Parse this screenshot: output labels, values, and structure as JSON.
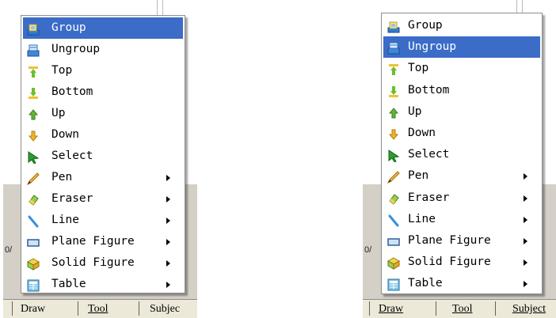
{
  "panels": [
    {
      "highlighted": 0,
      "partial_text": "0/",
      "menu": [
        {
          "label": "Group",
          "icon": "group-icon",
          "submenu": false
        },
        {
          "label": "Ungroup",
          "icon": "ungroup-icon",
          "submenu": false
        },
        {
          "label": "Top",
          "icon": "top-icon",
          "submenu": false
        },
        {
          "label": "Bottom",
          "icon": "bottom-icon",
          "submenu": false
        },
        {
          "label": "Up",
          "icon": "up-arrow-icon",
          "submenu": false
        },
        {
          "label": "Down",
          "icon": "down-arrow-icon",
          "submenu": false
        },
        {
          "label": "Select",
          "icon": "select-cursor-icon",
          "submenu": false
        },
        {
          "label": "Pen",
          "icon": "pen-icon",
          "submenu": true
        },
        {
          "label": "Eraser",
          "icon": "eraser-icon",
          "submenu": true
        },
        {
          "label": "Line",
          "icon": "line-icon",
          "submenu": true
        },
        {
          "label": "Plane Figure",
          "icon": "plane-figure-icon",
          "submenu": true
        },
        {
          "label": "Solid Figure",
          "icon": "solid-figure-icon",
          "submenu": true
        },
        {
          "label": "Table",
          "icon": "table-icon",
          "submenu": true
        }
      ],
      "tabs": [
        "Draw",
        "Tool",
        "Subjec"
      ]
    },
    {
      "highlighted": 1,
      "partial_text": "0/",
      "menu": [
        {
          "label": "Group",
          "icon": "group-icon",
          "submenu": false
        },
        {
          "label": "Ungroup",
          "icon": "ungroup-icon",
          "submenu": false
        },
        {
          "label": "Top",
          "icon": "top-icon",
          "submenu": false
        },
        {
          "label": "Bottom",
          "icon": "bottom-icon",
          "submenu": false
        },
        {
          "label": "Up",
          "icon": "up-arrow-icon",
          "submenu": false
        },
        {
          "label": "Down",
          "icon": "down-arrow-icon",
          "submenu": false
        },
        {
          "label": "Select",
          "icon": "select-cursor-icon",
          "submenu": false
        },
        {
          "label": "Pen",
          "icon": "pen-icon",
          "submenu": true
        },
        {
          "label": "Eraser",
          "icon": "eraser-icon",
          "submenu": true
        },
        {
          "label": "Line",
          "icon": "line-icon",
          "submenu": true
        },
        {
          "label": "Plane Figure",
          "icon": "plane-figure-icon",
          "submenu": true
        },
        {
          "label": "Solid Figure",
          "icon": "solid-figure-icon",
          "submenu": true
        },
        {
          "label": "Table",
          "icon": "table-icon",
          "submenu": true
        }
      ],
      "tabs": [
        "Draw",
        "Tool",
        "Subject"
      ]
    }
  ],
  "colors": {
    "highlight": "#3a6cc8",
    "toolbar": "#ece9d8",
    "background": "#d4d0c8"
  }
}
